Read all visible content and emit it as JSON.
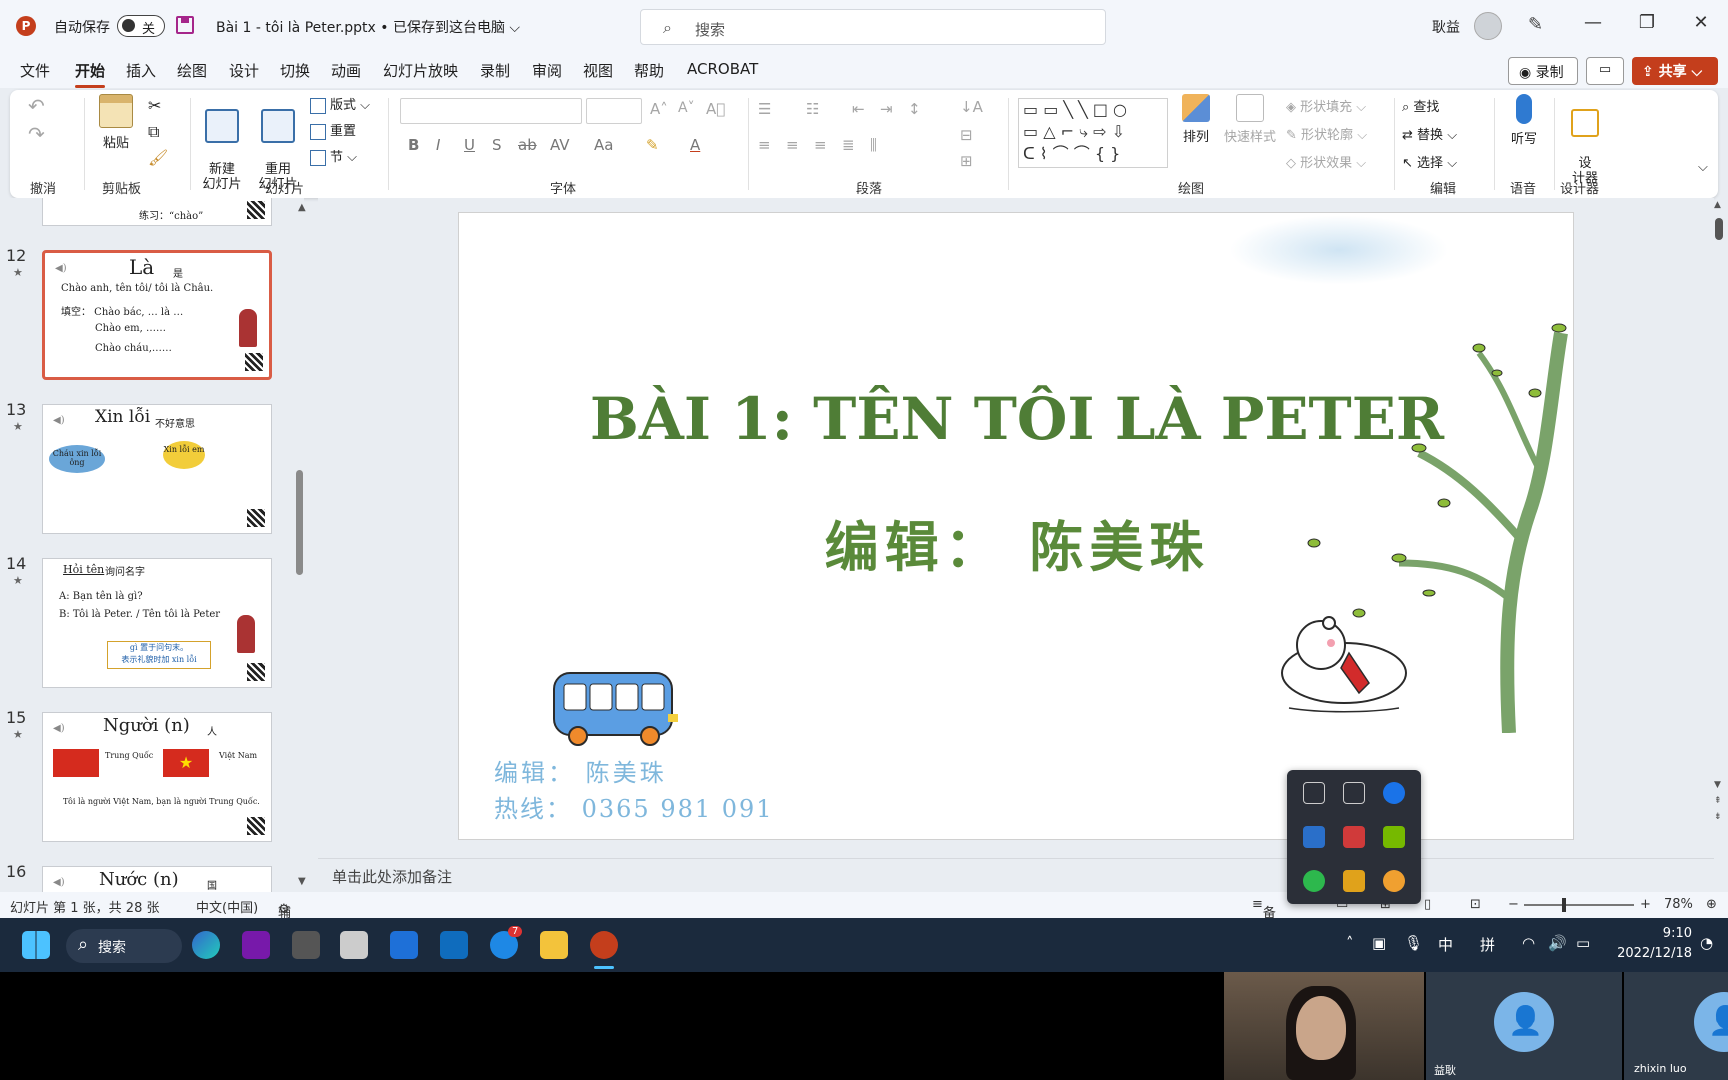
{
  "titlebar": {
    "autosave_label": "自动保存",
    "autosave_state": "关",
    "document_title": "Bài 1 - tôi là Peter.pptx • 已保存到这台电脑 ⌵",
    "search_placeholder": "搜索",
    "user_name": "耿益"
  },
  "menu": {
    "tabs": [
      "文件",
      "开始",
      "插入",
      "绘图",
      "设计",
      "切换",
      "动画",
      "幻灯片放映",
      "录制",
      "审阅",
      "视图",
      "帮助",
      "ACROBAT"
    ],
    "record_label": "录制",
    "share_label": "共享"
  },
  "ribbon": {
    "groups": {
      "undo": "撤消",
      "clipboard": "剪贴板",
      "slides": "幻灯片",
      "font": "字体",
      "paragraph": "段落",
      "drawing": "绘图",
      "editing": "编辑",
      "voice": "语音",
      "designer": "设计器"
    },
    "paste": "粘贴",
    "new_slide": "新建\n幻灯片",
    "reuse_slide": "重用\n幻灯片",
    "layout": "版式",
    "reset": "重置",
    "section": "节",
    "arrange": "排列",
    "quick_styles": "快速样式",
    "shape_fill": "形状填充",
    "shape_outline": "形状轮廓",
    "shape_effects": "形状效果",
    "find": "查找",
    "replace": "替换",
    "select": "选择",
    "dictate": "听写",
    "designer": "设\n计器"
  },
  "thumbnails": [
    {
      "num": "12",
      "title": "Là",
      "title_cn": "是",
      "lines": [
        "Chào anh, tên tôi/ tôi là Châu.",
        "填空： Chào bác, … là …",
        "Chào em, ……",
        "Chào cháu,……"
      ]
    },
    {
      "num": "13",
      "title": "Xin lỗi",
      "title_cn": "不好意思",
      "bubbles": [
        "Cháu xin lỗi ông",
        "Xin lỗi em"
      ]
    },
    {
      "num": "14",
      "title": "Hỏi tên",
      "title_cn": "询问名字",
      "lines": [
        "A: Bạn tên là gì?",
        "B: Tôi là Peter.  / Tên tôi là Peter",
        "gì 置于问句末。",
        "表示礼貌时加 xin lỗi"
      ]
    },
    {
      "num": "15",
      "title": "Người  (n)",
      "title_cn": "人",
      "lines": [
        "Trung Quốc",
        "Việt Nam",
        "Tôi là người Việt Nam, bạn là người Trung Quốc."
      ]
    },
    {
      "num": "16",
      "title": "Nước  (n)",
      "title_cn": "国"
    }
  ],
  "thumb_partial_text": "练习：“chào”",
  "slide": {
    "title": "BÀI 1: TÊN TÔI LÀ PETER",
    "subtitle": "编辑：  陈美珠",
    "editor_line": "编辑：  陈美珠",
    "hotline_line": "热线：  0365  981  091"
  },
  "notes_placeholder": "单击此处添加备注",
  "status": {
    "slide_counter": "幻灯片 第 1 张，共 28 张",
    "language": "中文(中国)",
    "accessibility": "辅助功能: 调查",
    "notes": "备注",
    "zoom": "78%"
  },
  "taskbar": {
    "search": "搜索",
    "ime_cn": "中",
    "ime_pin": "拼",
    "time": "9:10",
    "date": "2022/12/18",
    "skype_badge": "7"
  },
  "video": {
    "p2_name": "益耿",
    "p3_name": "zhixin luo"
  },
  "colors": {
    "accent": "#c43e1c",
    "title_green": "#4f7d36",
    "hotline_blue": "#7fb7dc"
  }
}
